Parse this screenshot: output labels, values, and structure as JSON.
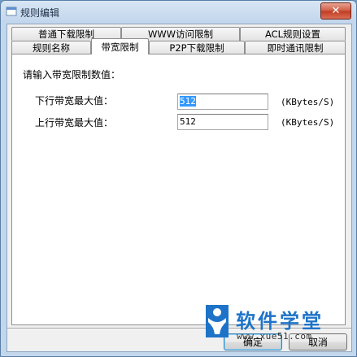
{
  "window": {
    "title": "规则编辑"
  },
  "tabs_back": [
    {
      "label": "普通下载限制"
    },
    {
      "label": "WWW访问限制"
    },
    {
      "label": "ACL规则设置"
    }
  ],
  "tabs_front": [
    {
      "label": "规则名称"
    },
    {
      "label": "带宽限制",
      "active": true
    },
    {
      "label": "P2P下载限制"
    },
    {
      "label": "即时通讯限制"
    }
  ],
  "bandwidth": {
    "prompt": "请输入带宽限制数值：",
    "download": {
      "label": "下行带宽最大值：",
      "value": "512",
      "unit": "(KBytes/S)"
    },
    "upload": {
      "label": "上行带宽最大值：",
      "value": "512",
      "unit": "(KBytes/S)"
    }
  },
  "watermark": {
    "title": "软件学堂",
    "url": "www.xue51.com"
  },
  "footer": {
    "ok_label": "确定",
    "cancel_label": "取消"
  },
  "colors": {
    "accent": "#1e73c8",
    "selection": "#3399ff",
    "close": "#c13a22"
  }
}
